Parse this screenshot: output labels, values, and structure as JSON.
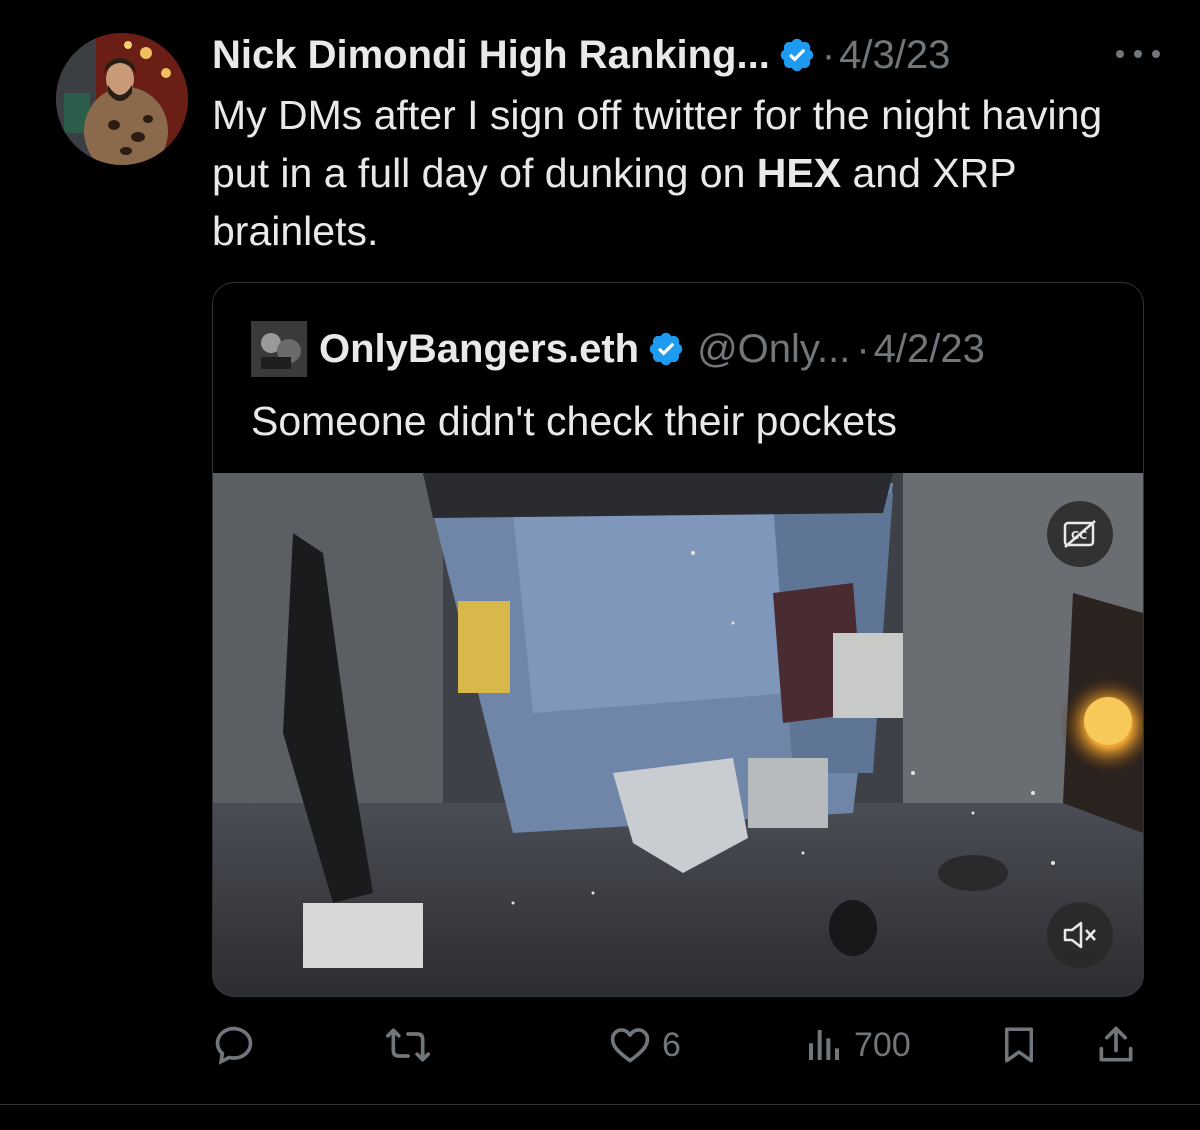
{
  "tweet": {
    "author_name": "Nick Dimondi High Ranking...",
    "separator": "·",
    "date": "4/3/23",
    "text_part1": "My DMs after I sign off twitter for the night having put in a full day of dunking on ",
    "text_bold": "HEX",
    "text_part2": " and XRP brainlets."
  },
  "quoted_tweet": {
    "author_name": "OnlyBangers.eth",
    "handle": "@Only...",
    "separator": "·",
    "date": "4/2/23",
    "text": "Someone didn't check their pockets"
  },
  "actions": {
    "likes": "6",
    "views": "700"
  },
  "colors": {
    "background": "#000000",
    "text": "#e7e9ea",
    "secondary": "#71767b",
    "verified": "#1d9bf0",
    "border": "#2f3336"
  },
  "icons": [
    "more-icon",
    "verified-badge-icon",
    "captions-icon",
    "mute-icon",
    "reply-icon",
    "retweet-icon",
    "like-icon",
    "views-icon",
    "bookmark-icon",
    "share-icon"
  ]
}
